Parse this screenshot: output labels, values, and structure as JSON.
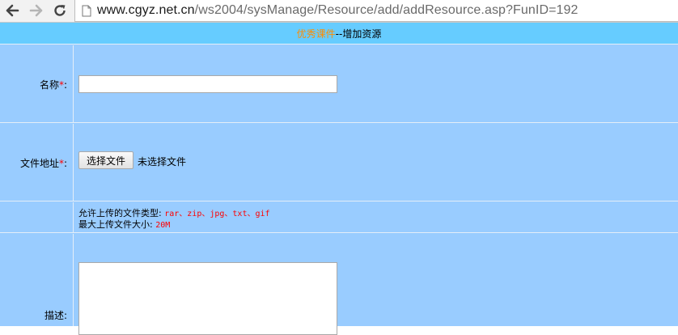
{
  "browser": {
    "url_host": "www.cgyz.net.cn",
    "url_path": "/ws2004/sysManage/Resource/add/addResource.asp?FunID=192"
  },
  "title_bar": {
    "section": "优秀课件",
    "separator_and_title": "--增加资源"
  },
  "form": {
    "name_label": "名称",
    "name_required": "*",
    "name_colon": ":",
    "name_value": "",
    "file_label": "文件地址",
    "file_required": "*",
    "file_colon": ":",
    "file_button": "选择文件",
    "file_status": "未选择文件",
    "allowed_types_label": "允许上传的文件类型:",
    "allowed_types_value": "rar、zip、jpg、txt、gif",
    "max_size_label": "最大上传文件大小:",
    "max_size_value": "20M",
    "desc_label": "描述:",
    "desc_value": ""
  },
  "colors": {
    "page_background": "#99ccff",
    "title_background": "#66ccff",
    "section_accent": "#ff8c00",
    "required_mark": "#ff0000"
  },
  "icons": {
    "back": "back-arrow-icon",
    "forward": "forward-arrow-icon",
    "reload": "reload-icon",
    "page": "page-icon"
  }
}
